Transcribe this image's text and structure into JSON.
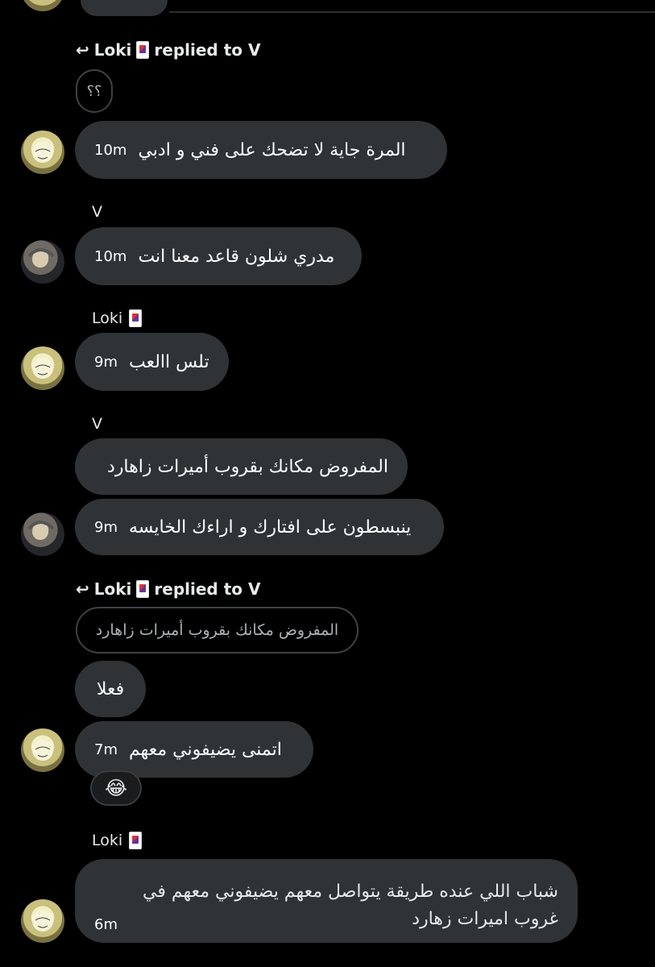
{
  "participants": {
    "loki": "Loki",
    "v": "V"
  },
  "reply_prefix_1": "Loki",
  "reply_suffix_1": "replied to V",
  "quote_1": "؟؟",
  "reply_prefix_2": "Loki",
  "reply_suffix_2": "replied to V",
  "quote_2": "المفروض مكانك بقروب أميرات زاهارد",
  "messages": [
    {
      "text": "المرة جاية لا تضحك على فني و ادبي",
      "time": "10m"
    },
    {
      "text": "مدري شلون قاعد معنا انت",
      "time": "10m"
    },
    {
      "text": "تلس االعب",
      "time": "9m"
    },
    {
      "text": "المفروض مكانك بقروب أميرات زاهارد",
      "time": ""
    },
    {
      "text": "ينبسطون على افتارك و اراءك الخايسه",
      "time": "9m"
    },
    {
      "text": "فعلا",
      "time": ""
    },
    {
      "text": "اتمنى يضيفوني معهم",
      "time": "7m"
    },
    {
      "line1": "شباب اللي عنده طريقة يتواصل معهم يضيفوني معهم في",
      "line2": "غروب اميرات زهارد",
      "time": "6m"
    }
  ],
  "reaction": "😂",
  "colors": {
    "bubble": "#2f3336",
    "background": "#000000",
    "text": "#e7e9ea"
  }
}
